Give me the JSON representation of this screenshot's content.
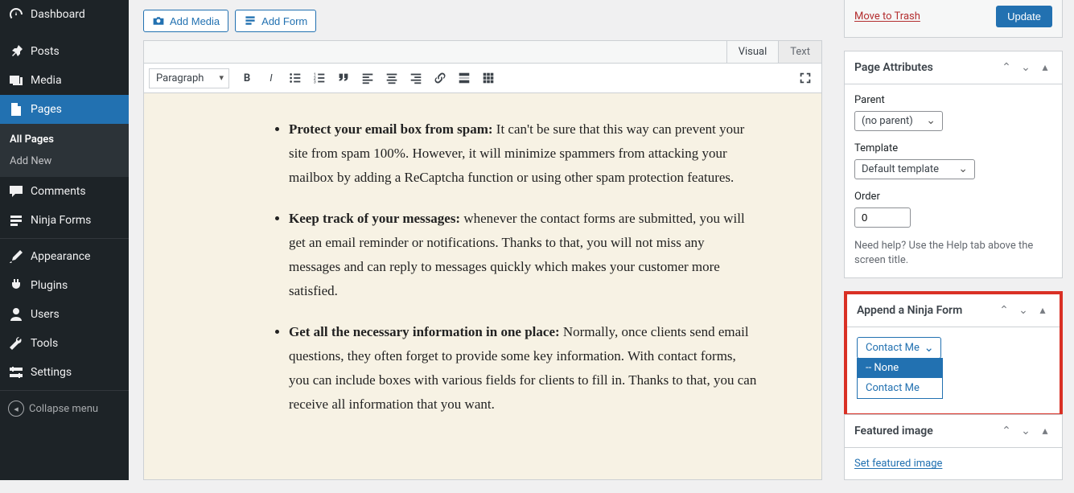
{
  "sidebar": {
    "items": [
      {
        "label": "Dashboard"
      },
      {
        "label": "Posts"
      },
      {
        "label": "Media"
      },
      {
        "label": "Pages"
      },
      {
        "label": "Comments"
      },
      {
        "label": "Ninja Forms"
      },
      {
        "label": "Appearance"
      },
      {
        "label": "Plugins"
      },
      {
        "label": "Users"
      },
      {
        "label": "Tools"
      },
      {
        "label": "Settings"
      }
    ],
    "sub_pages": [
      {
        "label": "All Pages"
      },
      {
        "label": "Add New"
      }
    ],
    "collapse_label": "Collapse menu"
  },
  "toolbar": {
    "add_media_label": "Add Media",
    "add_form_label": "Add Form"
  },
  "editor": {
    "tabs": {
      "visual": "Visual",
      "text": "Text"
    },
    "format_selected": "Paragraph",
    "content": {
      "b1_bold": "Protect your email box from spam:",
      "b1_rest": " It can't be sure that this way can prevent your site from spam 100%. However, it will minimize spammers from attacking your mailbox by adding a ReCaptcha function or using other spam protection features.",
      "b2_bold": "Keep track of your messages:",
      "b2_rest": " whenever the contact forms are submitted, you will get an email reminder or notifications. Thanks to that, you will not miss any messages and can reply to messages quickly which makes your customer more satisfied.",
      "b3_bold": "Get all the necessary information in one place:",
      "b3_rest": " Normally, once clients send email questions, they often forget to provide some key information. With contact forms, you can include boxes with various fields for clients to fill in. Thanks to that, you can receive all information that you want."
    }
  },
  "publish": {
    "trash_label": "Move to Trash",
    "update_label": "Update"
  },
  "page_attributes": {
    "title": "Page Attributes",
    "parent_label": "Parent",
    "parent_value": "(no parent)",
    "template_label": "Template",
    "template_value": "Default template",
    "order_label": "Order",
    "order_value": "0",
    "help_text": "Need help? Use the Help tab above the screen title."
  },
  "ninja": {
    "title": "Append a Ninja Form",
    "selected": "Contact Me",
    "options": [
      "-- None",
      "Contact Me"
    ]
  },
  "featured_image": {
    "title": "Featured image",
    "link_label": "Set featured image"
  }
}
